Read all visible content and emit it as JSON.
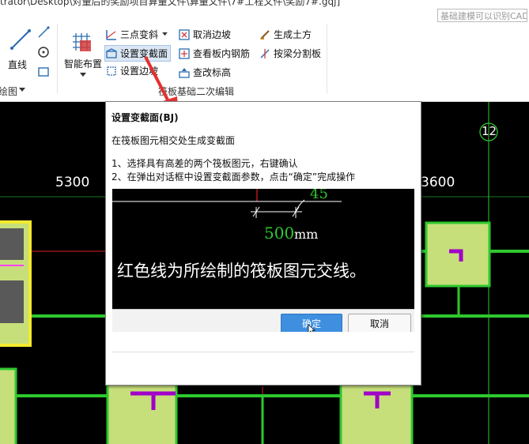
{
  "window": {
    "title": "trator\\Desktop\\对量后的奖励项目算量文件\\算量文件\\7#工程文件\\奖励7#.gqj]",
    "search_placeholder": "基础建模可以识别CAD"
  },
  "ribbon": {
    "left_label": "绘图",
    "line_tool": "直线",
    "smart_layout": "智能布置",
    "three_point_slope": "三点变斜",
    "set_variable_section": "设置变截面",
    "set_edge_slope": "设置边坡",
    "cancel_edge_slope": "取消边坡",
    "view_slab_rebar": "查看板内钢筋",
    "change_elevation": "查改标高",
    "generate_earthwork": "生成土方",
    "split_by_beam": "按梁分割板",
    "group_label": "筏板基础二次编辑"
  },
  "cad": {
    "dim_left": "5300",
    "dim_right": "3600",
    "axis_label": "12"
  },
  "tooltip": {
    "title": "设置变截面(BJ)",
    "description": "在筏板图元相交处生成变截面",
    "step1": "1、选择具有高差的两个筏板图元，右键确认",
    "step2": "2、在弹出对话框中设置变截面参数，点击“确定”完成操作",
    "image": {
      "angle": "45",
      "dimension_value": "500",
      "dimension_unit": "mm",
      "caption": "红色线为所绘制的筏板图元交线。",
      "ok_button": "确定",
      "cancel_button": "取消"
    }
  },
  "colors": {
    "cad_background": "#000000",
    "slab_fill": "#c6df7a",
    "slab_border": "#2ec82e",
    "axis_red": "#e02020",
    "beam_purple": "#a000c8",
    "yellow_highlight": "#f3ea2e",
    "button_blue": "#3f8fe0"
  }
}
